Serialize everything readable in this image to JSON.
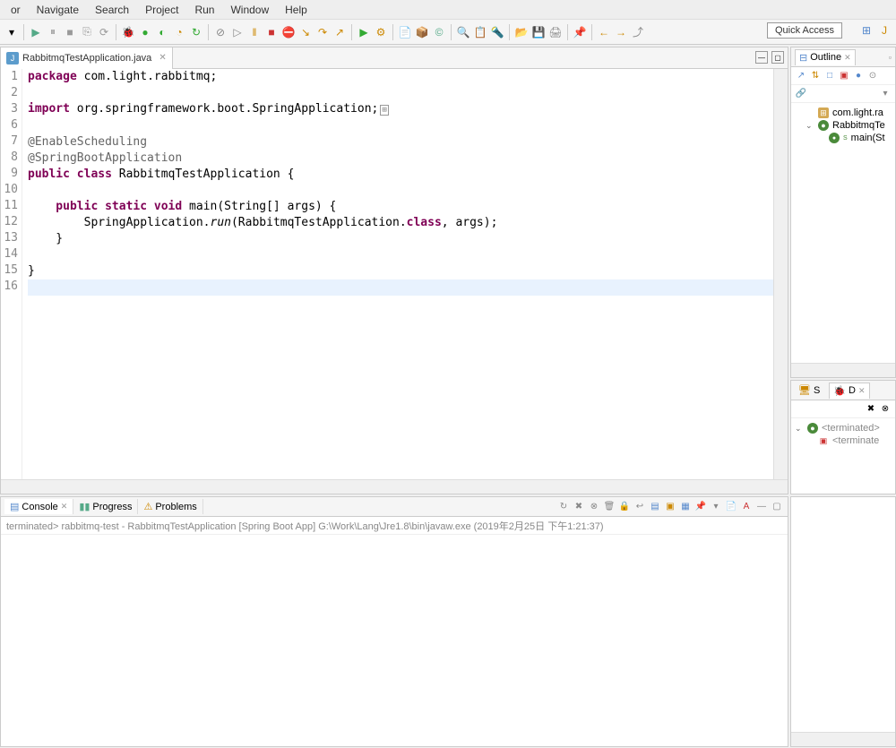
{
  "menus": [
    "or",
    "Navigate",
    "Search",
    "Project",
    "Run",
    "Window",
    "Help"
  ],
  "quick_access": "Quick Access",
  "editor": {
    "tab_name": "RabbitmqTestApplication.java",
    "lines": [
      {
        "n": 1,
        "fragments": [
          {
            "t": "package ",
            "c": "kw"
          },
          {
            "t": "com.light.rabbitmq;",
            "c": ""
          }
        ]
      },
      {
        "n": 2,
        "fragments": []
      },
      {
        "n": 3,
        "marker": true,
        "fragments": [
          {
            "t": "import ",
            "c": "kw"
          },
          {
            "t": "org.springframework.boot.SpringApplication;",
            "c": ""
          },
          {
            "t": "⊞",
            "c": "box"
          }
        ]
      },
      {
        "n": 6,
        "fragments": []
      },
      {
        "n": 7,
        "fragments": [
          {
            "t": "@EnableScheduling",
            "c": "ann"
          }
        ]
      },
      {
        "n": 8,
        "fragments": [
          {
            "t": "@SpringBootApplication",
            "c": "ann"
          }
        ]
      },
      {
        "n": 9,
        "fragments": [
          {
            "t": "public class ",
            "c": "kw"
          },
          {
            "t": "RabbitmqTestApplication {",
            "c": ""
          }
        ]
      },
      {
        "n": 10,
        "fragments": []
      },
      {
        "n": 11,
        "marker": true,
        "fragments": [
          {
            "t": "    public static void ",
            "c": "kw"
          },
          {
            "t": "main(String[] args) {",
            "c": ""
          }
        ]
      },
      {
        "n": 12,
        "fragments": [
          {
            "t": "        SpringApplication.",
            "c": ""
          },
          {
            "t": "run",
            "c": "it"
          },
          {
            "t": "(RabbitmqTestApplication.",
            "c": ""
          },
          {
            "t": "class",
            "c": "kw"
          },
          {
            "t": ", args);",
            "c": ""
          }
        ]
      },
      {
        "n": 13,
        "fragments": [
          {
            "t": "    }",
            "c": ""
          }
        ]
      },
      {
        "n": 14,
        "fragments": []
      },
      {
        "n": 15,
        "fragments": [
          {
            "t": "}",
            "c": ""
          }
        ]
      },
      {
        "n": 16,
        "hl": true,
        "fragments": []
      }
    ]
  },
  "outline": {
    "title": "Outline",
    "items": [
      {
        "icon": "pkg",
        "label": "com.light.ra",
        "indent": 1
      },
      {
        "icon": "cls",
        "label": "RabbitmqTe",
        "indent": 1,
        "exp": "⌄"
      },
      {
        "icon": "mth",
        "label": "main(St",
        "indent": 2,
        "sup": "S"
      }
    ]
  },
  "servers_debug": {
    "tab_s": "S",
    "tab_d": "D",
    "items": [
      {
        "icon": "cls",
        "label": "<terminated>",
        "exp": "⌄",
        "indent": 0
      },
      {
        "icon": "x",
        "label": "<terminate",
        "indent": 1
      }
    ]
  },
  "console": {
    "tabs": [
      {
        "label": "Console",
        "active": true
      },
      {
        "label": "Progress",
        "active": false
      },
      {
        "label": "Problems",
        "active": false
      }
    ],
    "status": "terminated> rabbitmq-test - RabbitmqTestApplication [Spring Boot App] G:\\Work\\Lang\\Jre1.8\\bin\\javaw.exe (2019年2月25日 下午1:21:37)"
  }
}
